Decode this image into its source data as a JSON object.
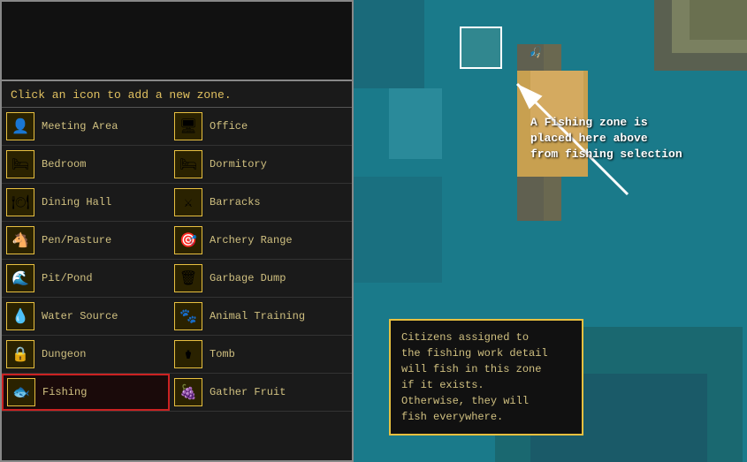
{
  "left_panel": {
    "instruction": "Click an icon to add a new zone.",
    "zones": [
      {
        "id": "meeting-area",
        "label": "Meeting Area",
        "icon": "👤",
        "col": 0
      },
      {
        "id": "office",
        "label": "Office",
        "icon": "🖥",
        "col": 1
      },
      {
        "id": "bedroom",
        "label": "Bedroom",
        "icon": "🛏",
        "col": 0
      },
      {
        "id": "dormitory",
        "label": "Dormitory",
        "icon": "🛏",
        "col": 1
      },
      {
        "id": "dining-hall",
        "label": "Dining Hall",
        "icon": "🍽",
        "col": 0
      },
      {
        "id": "barracks",
        "label": "Barracks",
        "icon": "⚔",
        "col": 1
      },
      {
        "id": "pen-pasture",
        "label": "Pen/Pasture",
        "icon": "🐴",
        "col": 0
      },
      {
        "id": "archery-range",
        "label": "Archery Range",
        "icon": "🎯",
        "col": 1
      },
      {
        "id": "pit-pond",
        "label": "Pit/Pond",
        "icon": "🌊",
        "col": 0
      },
      {
        "id": "garbage-dump",
        "label": "Garbage Dump",
        "icon": "🗑",
        "col": 1
      },
      {
        "id": "water-source",
        "label": "Water Source",
        "icon": "💧",
        "col": 0
      },
      {
        "id": "animal-training",
        "label": "Animal Training",
        "icon": "🐾",
        "col": 1
      },
      {
        "id": "dungeon",
        "label": "Dungeon",
        "icon": "🔒",
        "col": 0
      },
      {
        "id": "tomb",
        "label": "Tomb",
        "icon": "⚱",
        "col": 1
      },
      {
        "id": "fishing",
        "label": "Fishing",
        "icon": "🐟",
        "col": 0,
        "selected": true
      },
      {
        "id": "gather-fruit",
        "label": "Gather Fruit",
        "icon": "🍇",
        "col": 1
      }
    ]
  },
  "annotation": {
    "line1": "A Fishing zone is",
    "line2": "placed here above",
    "line3": "from fishing selection"
  },
  "info_box": {
    "text": "Citizens assigned to\nthe fishing work detail\nwill fish in this zone\nif it exists.\nOtherwise, they will\nfish everywhere."
  }
}
